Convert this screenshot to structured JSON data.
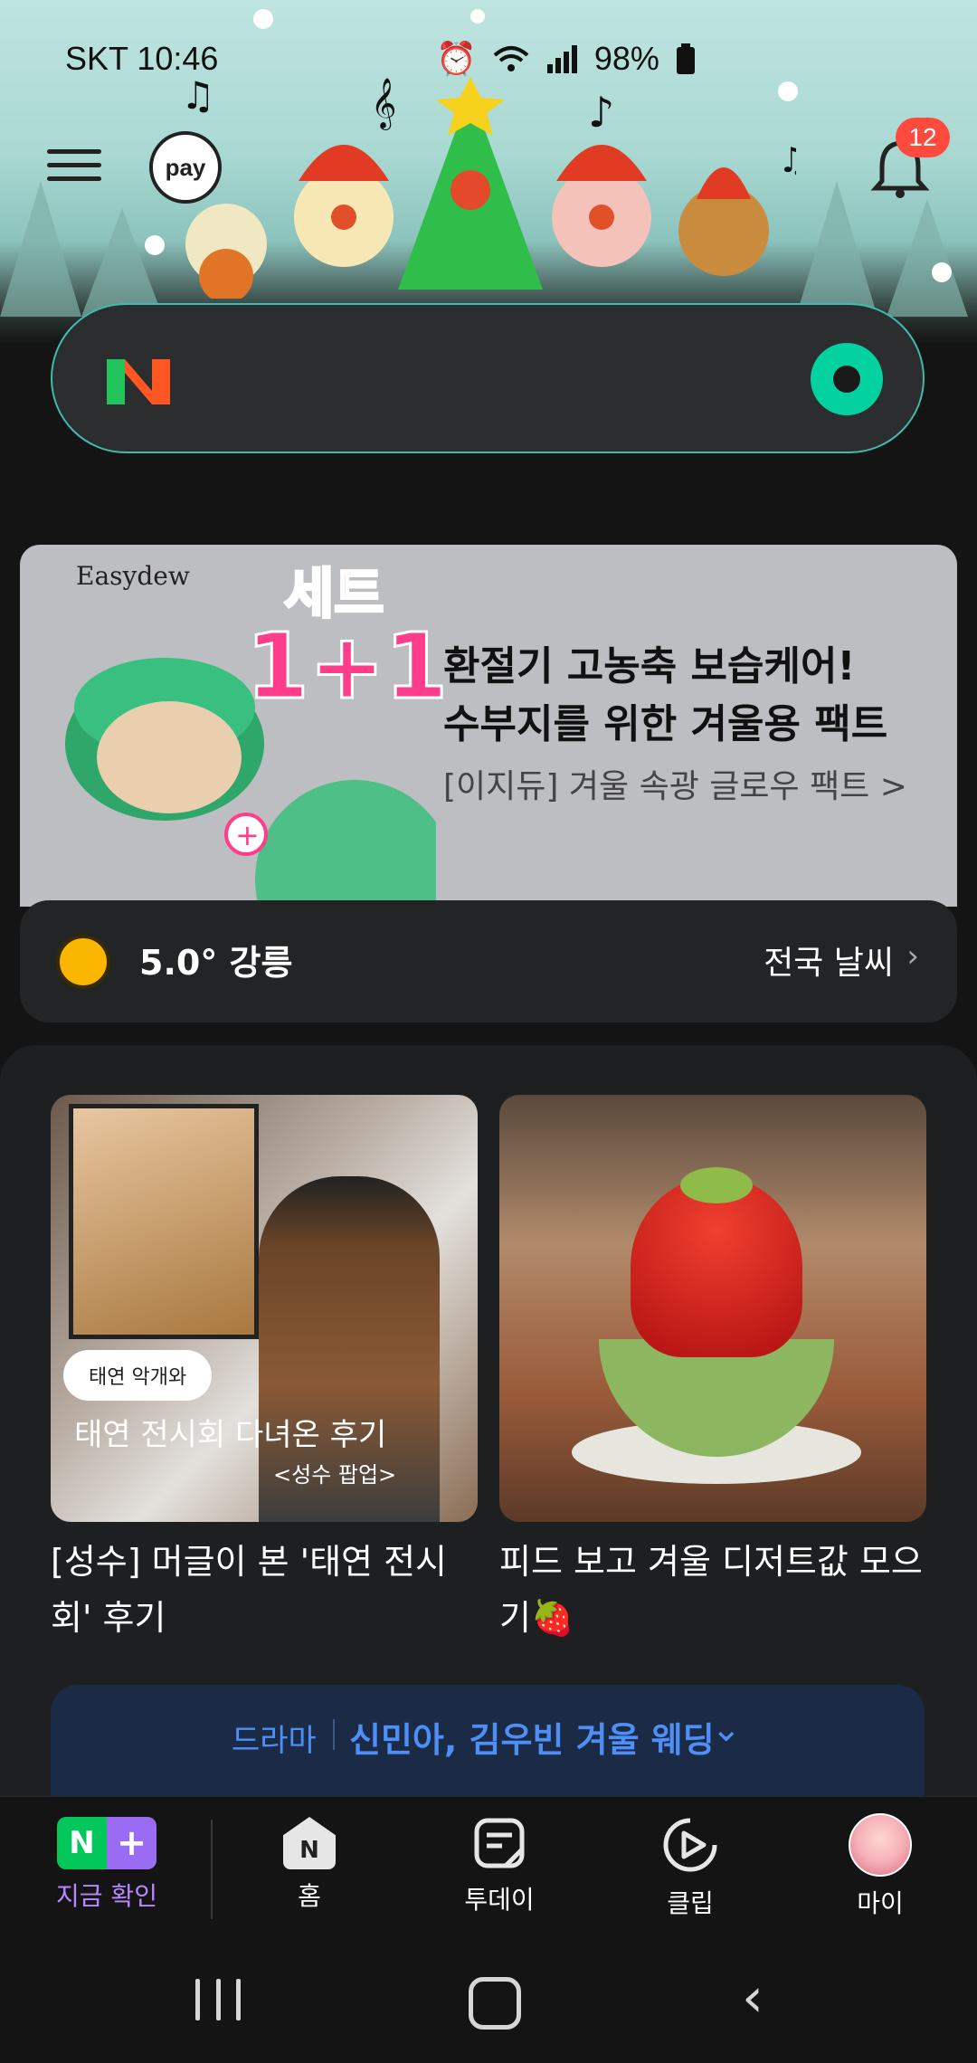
{
  "status_bar": {
    "carrier_time": "SKT 10:46",
    "battery": "98%"
  },
  "header": {
    "pay_label": "pay",
    "notification_count": "12"
  },
  "ad": {
    "brand": "Easydew",
    "set_label": "세트",
    "promo": "1+1",
    "headline_1": "환절기 고농축 보습케어!",
    "headline_2": "수부지를 위한 겨울용 팩트",
    "subline": "[이지듀] 겨울 속광 글로우 팩트 >"
  },
  "weather": {
    "temp_city": "5.0° 강릉",
    "nationwide": "전국 날씨"
  },
  "feed": {
    "cards": [
      {
        "bubble": "태연 악개와",
        "overlay_title": "태연 전시회 다녀온 후기",
        "overlay_sub": "<성수 팝업>",
        "title": "[성수] 머글이 본 '태연 전시회' 후기"
      },
      {
        "title": "피드 보고 겨울 디저트값 모으기🍓"
      }
    ],
    "drama": {
      "category": "드라마",
      "headline": "신민아, 김우빈 겨울 웨딩"
    }
  },
  "tabbar": {
    "check_n": "N",
    "check_plus": "+",
    "check": "지금 확인",
    "home_n": "N",
    "home": "홈",
    "today": "투데이",
    "clip": "클립",
    "my": "마이"
  },
  "colors": {
    "accent_green": "#03c75a",
    "accent_purple": "#9a6cf3",
    "drama_blue": "#4e8ef7",
    "badge_red": "#ff4b3e"
  }
}
